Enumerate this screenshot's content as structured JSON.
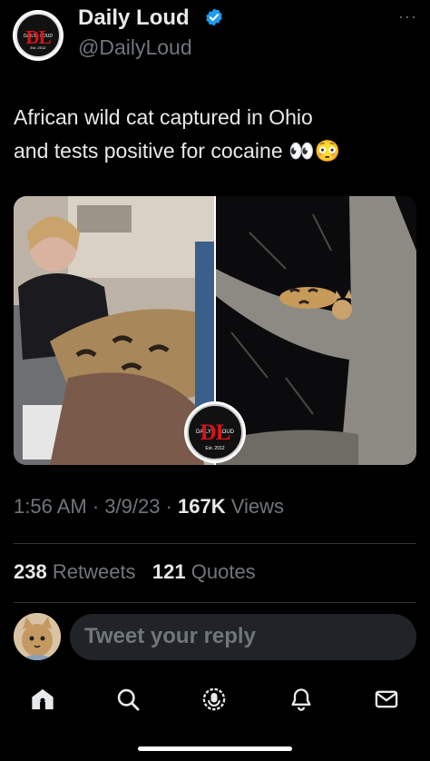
{
  "header": {
    "display_name": "Daily Loud",
    "handle": "@DailyLoud",
    "more_label": "···",
    "logo": {
      "main": "DL",
      "left": "DAILY",
      "right": "LOUD",
      "est": "Est. 2012"
    }
  },
  "tweet": {
    "text_line1": "African wild cat captured in Ohio",
    "text_line2": "and tests positive for cocaine 👀😳",
    "media_logo": {
      "main": "DL",
      "left": "DAILY",
      "right": "LOUD",
      "est": "Est. 2012"
    }
  },
  "meta": {
    "time": "1:56 AM",
    "sep1": "·",
    "date": "3/9/23",
    "sep2": "·",
    "views_count": "167K",
    "views_label": "Views"
  },
  "stats": {
    "retweets_count": "238",
    "retweets_label": "Retweets",
    "quotes_count": "121",
    "quotes_label": "Quotes"
  },
  "reply": {
    "placeholder": "Tweet your reply"
  },
  "nav": {
    "items": [
      "home-icon",
      "search-icon",
      "spaces-icon",
      "notifications-icon",
      "messages-icon"
    ]
  },
  "colors": {
    "background": "#000000",
    "text": "#e7e9ea",
    "muted": "#71767b",
    "verified": "#1d9bf0",
    "brand_red": "#d7141a",
    "divider": "#2f3336",
    "reply_box": "#202327"
  }
}
